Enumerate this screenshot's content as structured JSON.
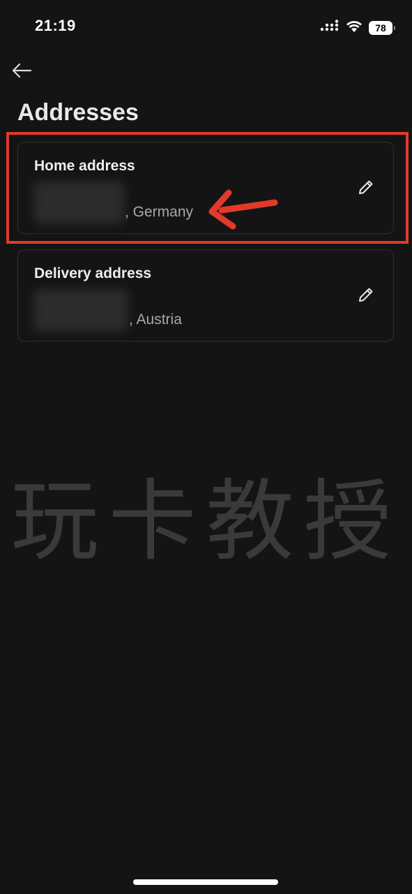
{
  "status_bar": {
    "time": "21:19",
    "battery_level": "78",
    "icons": [
      "cellular-signal-icon",
      "wifi-icon",
      "battery-icon"
    ]
  },
  "nav": {
    "back_icon": "arrow-left-icon"
  },
  "page": {
    "title": "Addresses"
  },
  "addresses": [
    {
      "label": "Home address",
      "country_suffix": ", Germany",
      "edit_icon": "pencil-icon",
      "highlighted": true
    },
    {
      "label": "Delivery address",
      "country_suffix": ", Austria",
      "edit_icon": "pencil-icon",
      "highlighted": false
    }
  ],
  "annotation": {
    "highlight_color": "#e2392b",
    "arrow_icon": "arrow-left-annotation-icon"
  },
  "watermark": {
    "text": "玩卡教授"
  },
  "colors": {
    "background": "#141414",
    "card_border": "#2e2e2e",
    "text_primary": "#eeeeee",
    "text_secondary": "#a9a9a9"
  }
}
